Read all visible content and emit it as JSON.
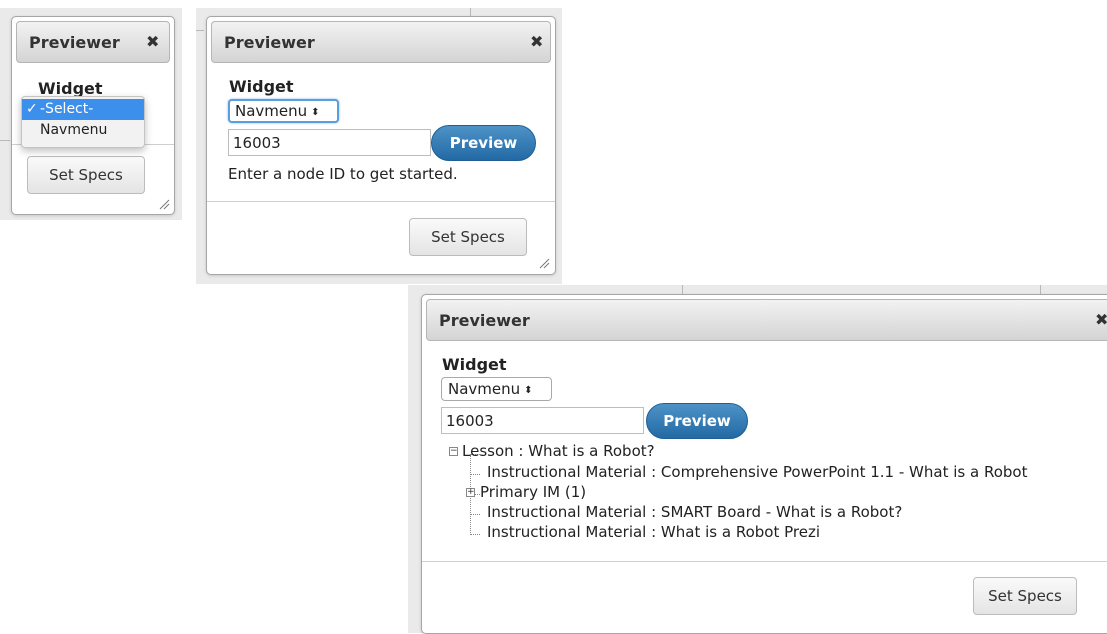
{
  "dialog_small": {
    "title": "Previewer",
    "close_label": "✖",
    "widget_label": "Widget",
    "dropdown_options": [
      {
        "check": "✓",
        "label": "-Select-"
      },
      {
        "check": "",
        "label": "Navmenu"
      }
    ],
    "set_specs_label": "Set Specs"
  },
  "dialog_medium": {
    "title": "Previewer",
    "close_label": "✖",
    "widget_label": "Widget",
    "select_value": "Navmenu",
    "node_id": "16003",
    "preview_label": "Preview",
    "hint": "Enter a node ID to get started.",
    "set_specs_label": "Set Specs"
  },
  "dialog_large": {
    "title": "Previewer",
    "close_label": "✖",
    "widget_label": "Widget",
    "select_value": "Navmenu",
    "node_id": "16003",
    "preview_label": "Preview",
    "tree": {
      "root": "Lesson : What is a Robot?",
      "children": [
        "Instructional Material : Comprehensive PowerPoint 1.1 - What is a Robot",
        "Primary IM (1)",
        "Instructional Material : SMART Board - What is a Robot?",
        "Instructional Material : What is a Robot Prezi"
      ]
    },
    "set_specs_label": "Set Specs"
  },
  "icons": {
    "select_arrows": "updown-arrows-icon",
    "close": "close-icon",
    "resize": "resize-grip-icon",
    "tree_collapse": "minus-box-icon",
    "tree_expand": "plus-box-icon"
  },
  "colors": {
    "preview_button": "#2e78b4",
    "dropdown_selected": "#3c8fea",
    "focus_ring": "#5b9ddd"
  }
}
